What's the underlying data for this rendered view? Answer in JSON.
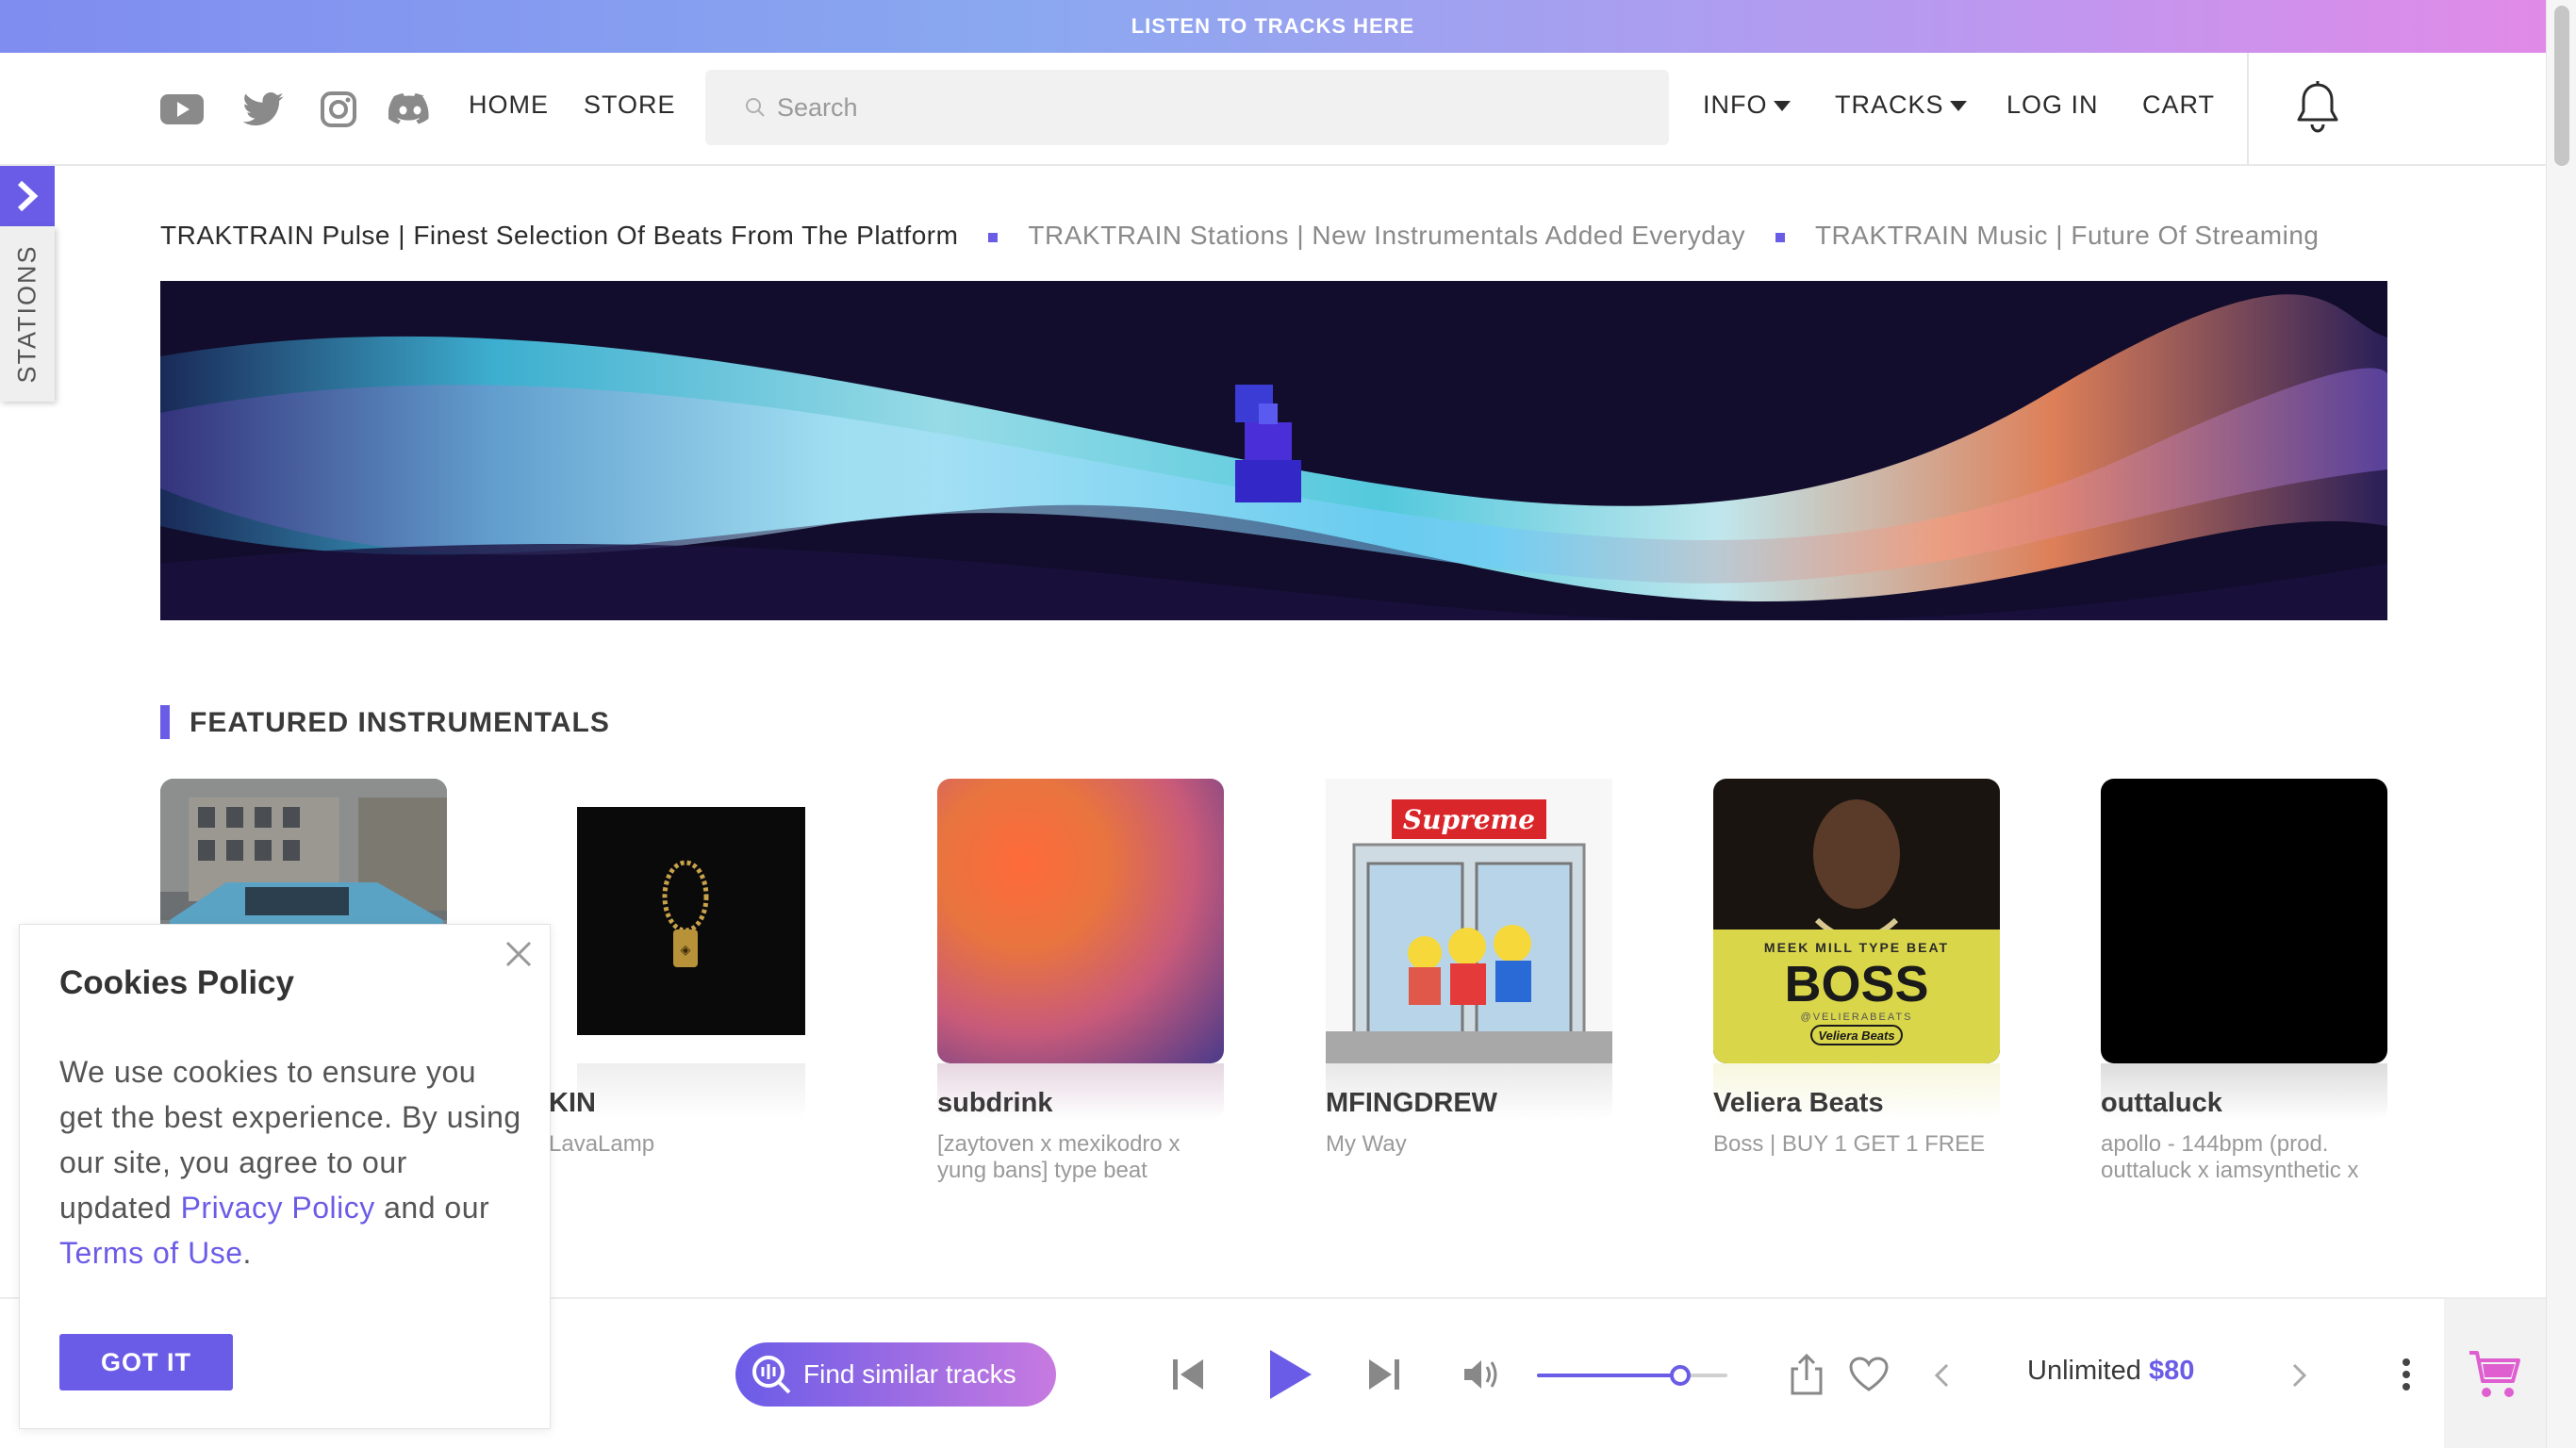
{
  "banner": {
    "text": "LISTEN TO TRACKS HERE"
  },
  "header": {
    "social": [
      "youtube-icon",
      "twitter-icon",
      "instagram-icon",
      "discord-icon"
    ],
    "nav_left": [
      "HOME",
      "STORE"
    ],
    "search_placeholder": "Search",
    "nav_right": {
      "info": "INFO",
      "tracks": "TRACKS",
      "login": "LOG IN",
      "cart": "CART"
    }
  },
  "stations": {
    "label": "STATIONS"
  },
  "ticker": [
    "TRAKTRAIN Pulse | Finest Selection Of Beats From The Platform",
    "TRAKTRAIN Stations | New Instrumentals Added Everyday",
    "TRAKTRAIN Music | Future Of Streaming"
  ],
  "featured": {
    "title": "FEATURED INSTRUMENTALS",
    "cards": [
      {
        "artist": "",
        "title": ""
      },
      {
        "artist": "KIN",
        "title": "LavaLamp"
      },
      {
        "artist": "subdrink",
        "title": "[zaytoven x mexikodro x yung bans] type beat"
      },
      {
        "artist": "MFINGDREW",
        "title": "My Way"
      },
      {
        "artist": "Veliera Beats",
        "title": "Boss | BUY 1 GET 1 FREE"
      },
      {
        "artist": "outtaluck",
        "title": "apollo - 144bpm (prod. outtaluck x iamsynthetic x"
      }
    ],
    "cover_text": {
      "supreme": "Supreme",
      "boss_top": "MEEK MILL TYPE BEAT",
      "boss_main": "BOSS",
      "boss_handle": "@VELIERABEATS",
      "boss_brand": "Veliera Beats"
    }
  },
  "player": {
    "similar_label": "Find similar tracks",
    "volume": 0.75,
    "license_label": "Unlimited",
    "license_price": "$80"
  },
  "cookies": {
    "title": "Cookies Policy",
    "text_before": "We use cookies to ensure you get the best experience. By using our site, you agree to our updated",
    "privacy_link": "Privacy Policy",
    "text_middle": "and our",
    "terms_link": "Terms of Use",
    "text_end": ".",
    "button": "GOT IT"
  },
  "colors": {
    "accent": "#6b5ce7",
    "accent_pink": "#c77ae0",
    "cart_pink": "#e05fd0"
  }
}
